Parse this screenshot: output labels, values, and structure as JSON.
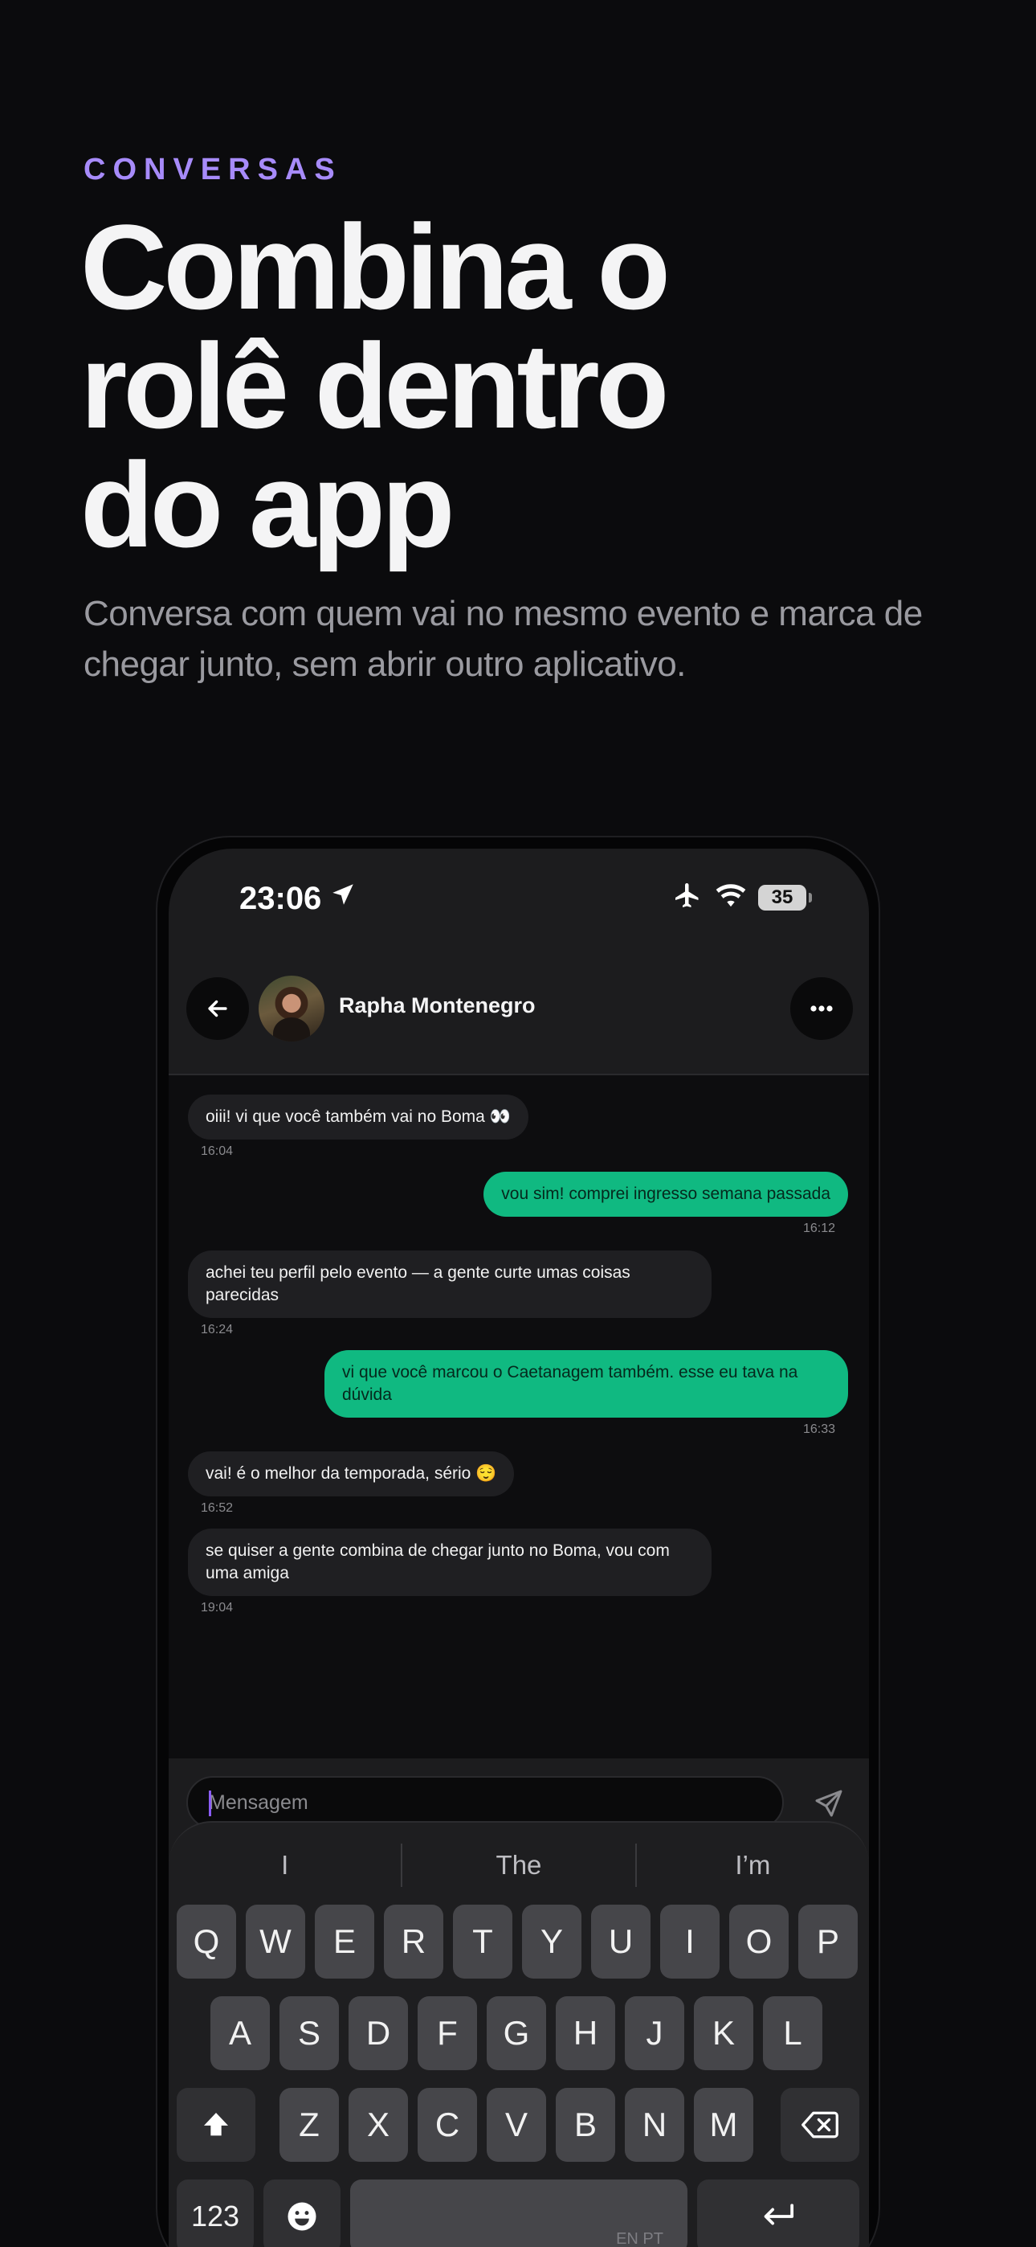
{
  "hero": {
    "eyebrow": "CONVERSAS",
    "headline_line1": "Combina o",
    "headline_line2": "rolê dentro",
    "headline_line3": "do app",
    "subtitle": "Conversa com quem vai no mesmo evento e marca de chegar junto, sem abrir outro aplicativo."
  },
  "status_bar": {
    "time": "23:06",
    "battery": "35",
    "icons": [
      "location-arrow-icon",
      "airplane-icon",
      "wifi-icon",
      "battery-icon"
    ]
  },
  "chat": {
    "contact_name": "Rapha Montenegro",
    "messages": [
      {
        "side": "in",
        "text": "oiii! vi que você também vai no Boma 👀",
        "time": "16:04"
      },
      {
        "side": "out",
        "text": "vou sim! comprei ingresso semana passada",
        "time": "16:12"
      },
      {
        "side": "in",
        "text": "achei teu perfil pelo evento — a gente curte umas coisas parecidas",
        "time": "16:24"
      },
      {
        "side": "out",
        "text": "vi que você marcou o Caetanagem também. esse eu tava na dúvida",
        "time": "16:33"
      },
      {
        "side": "in",
        "text": "vai! é o melhor da temporada, sério 😌",
        "time": "16:52"
      },
      {
        "side": "in",
        "text": "se quiser a gente combina de chegar junto no Boma, vou com uma amiga",
        "time": "19:04"
      }
    ],
    "input_placeholder": "Mensagem"
  },
  "keyboard": {
    "suggestions": [
      "I",
      "The",
      "I’m"
    ],
    "row1": [
      "Q",
      "W",
      "E",
      "R",
      "T",
      "Y",
      "U",
      "I",
      "O",
      "P"
    ],
    "row2": [
      "A",
      "S",
      "D",
      "F",
      "G",
      "H",
      "J",
      "K",
      "L"
    ],
    "row3": [
      "Z",
      "X",
      "C",
      "V",
      "B",
      "N",
      "M"
    ],
    "numbers_key": "123",
    "language": "EN PT"
  },
  "colors": {
    "accent": "#a78bfa",
    "outgoing_bubble": "#10b981",
    "incoming_bubble": "#1f1f22",
    "background": "#0b0b0d"
  }
}
